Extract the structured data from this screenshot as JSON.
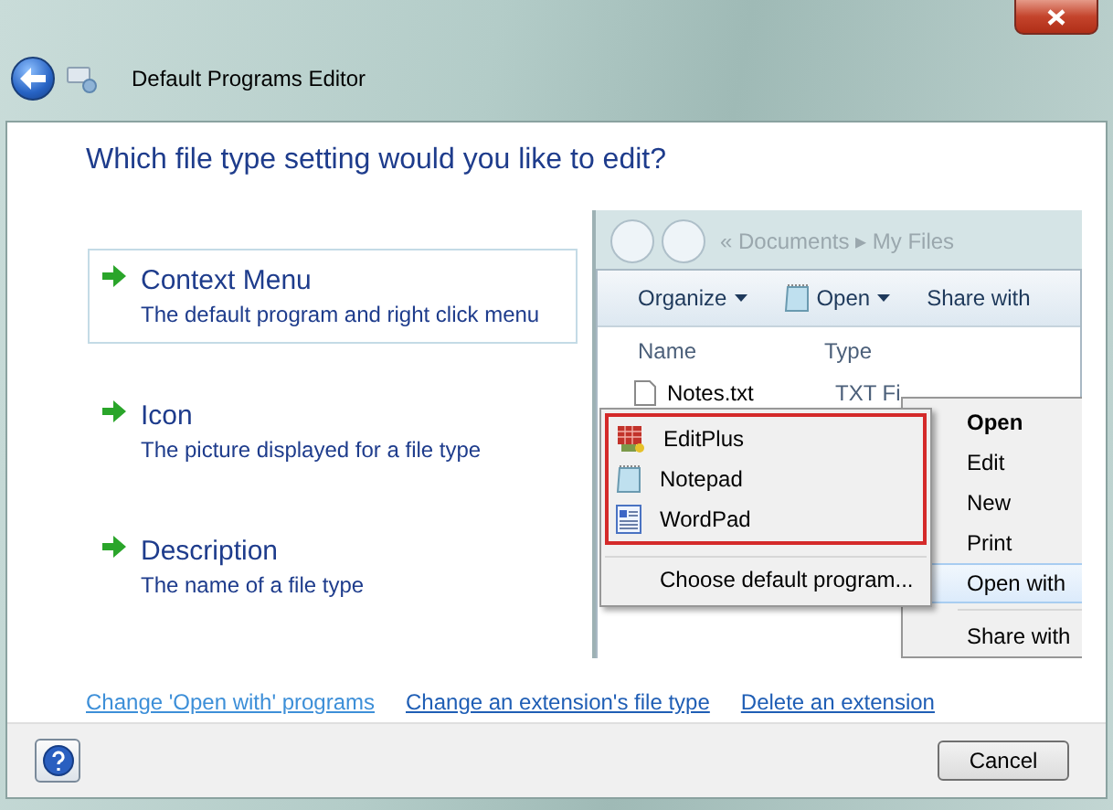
{
  "window": {
    "title": "Default Programs Editor"
  },
  "heading": "Which file type setting would you like to edit?",
  "options": [
    {
      "title": "Context Menu",
      "description": "The default program and right click menu",
      "selected": true
    },
    {
      "title": "Icon",
      "description": "The picture displayed for a file type",
      "selected": false
    },
    {
      "title": "Description",
      "description": "The name of a file type",
      "selected": false
    }
  ],
  "preview": {
    "address": "« Documents ▸ My Files",
    "toolbar": [
      {
        "label": "Organize",
        "icon": false,
        "caret": true
      },
      {
        "label": "Open",
        "icon": true,
        "caret": true
      },
      {
        "label": "Share with",
        "icon": false,
        "caret": false
      }
    ],
    "columns": [
      "Name",
      "Type"
    ],
    "file": {
      "name": "Notes.txt",
      "type": "TXT Fi"
    },
    "context_menu": [
      {
        "kind": "item",
        "label": "Open",
        "bold": true,
        "selected": false
      },
      {
        "kind": "item",
        "label": "Edit",
        "bold": false,
        "selected": false
      },
      {
        "kind": "item",
        "label": "New",
        "bold": false,
        "selected": false
      },
      {
        "kind": "item",
        "label": "Print",
        "bold": false,
        "selected": false
      },
      {
        "kind": "item",
        "label": "Open with",
        "bold": false,
        "selected": true
      },
      {
        "kind": "separator"
      },
      {
        "kind": "item",
        "label": "Share with",
        "bold": false,
        "selected": false
      }
    ],
    "submenu": {
      "programs": [
        {
          "label": "EditPlus",
          "kind": "grid"
        },
        {
          "label": "Notepad",
          "kind": "pad"
        },
        {
          "label": "WordPad",
          "kind": "doc"
        }
      ],
      "footer": "Choose default program..."
    }
  },
  "links": [
    {
      "label": "Change 'Open with' programs",
      "visited": true
    },
    {
      "label": "Change an extension's file type",
      "visited": false
    },
    {
      "label": "Delete an extension",
      "visited": false
    }
  ],
  "buttons": [
    "Cancel"
  ]
}
